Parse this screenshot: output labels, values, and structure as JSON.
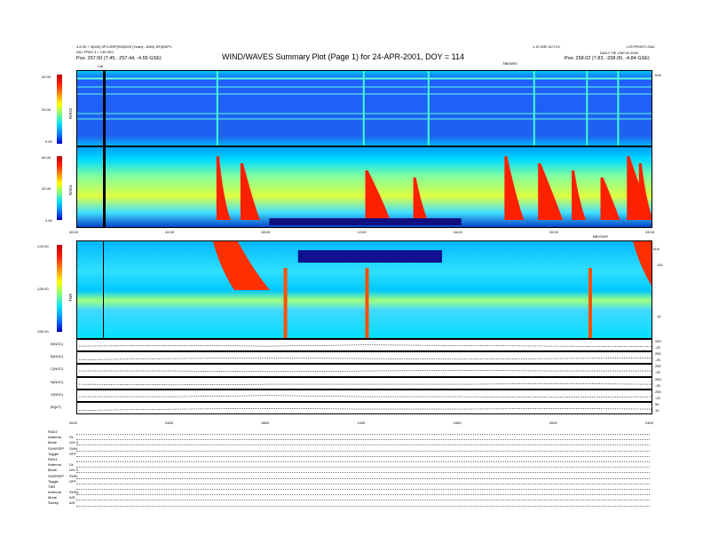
{
  "header": {
    "title": "WIND/WAVES Summary Plot (Page 1) for 24-APR-2001, DOY = 114",
    "topleft_line1": "4.5.30 + 3(000) SPC/SRP(500)000 (Yearly - ANN) DF@3/PC",
    "topleft_line2": "ASJ PRIIS 3 = 135 0E0",
    "position_left": "Pos:    257.50 (7.45, -257.44, -4.55 GSE)",
    "topright_line1": "1.10 WEI 01/TC0",
    "topright_line2": "L39 FRONT=SAC",
    "topright_line3": "DAILY TIE CNP IN 2000",
    "position_right": "Pos:    258.02 (7.83, -258.05, -4.84 GSE)",
    "center_right_label": "TBEWEE",
    "cal_marker": "Cal"
  },
  "panels": {
    "rad2": {
      "name": "RAD2",
      "ticks": [
        "40.00",
        "20.00",
        "0.00"
      ],
      "right_unit": "kHz"
    },
    "rad1": {
      "name": "RAD1",
      "ticks": [
        "60.00",
        "30.00",
        "0.00"
      ]
    },
    "tnr": {
      "name": "TNR",
      "ticks": [
        "-120.00",
        "-135.00",
        "-150.00"
      ],
      "right_ticks": [
        "100",
        "10"
      ],
      "right_top_label": "BBV/SDF",
      "right_top_sublabel": "kHz"
    },
    "time_axis_upper": [
      "00:00",
      "04:00",
      "08:00",
      "12:00",
      "16:00",
      "20:00",
      "24:00"
    ],
    "time_axis_lower": [
      "0000",
      "0400",
      "0800",
      "1200",
      "1600",
      "2000",
      "2400"
    ]
  },
  "mag_panels": [
    {
      "label": "B(NOC)",
      "r1": "250",
      "r2": "-25"
    },
    {
      "label": "B(NOC)",
      "r1": "250",
      "r2": "-25"
    },
    {
      "label": "C(NOC)",
      "r1": "250",
      "r2": "-25"
    },
    {
      "label": "N(NOC)",
      "r1": "250",
      "r2": "-25"
    },
    {
      "label": "V(NOC)",
      "r1": "250",
      "r2": "-25"
    },
    {
      "label": "|B|(nT)",
      "r1": "50",
      "r2": "15"
    }
  ],
  "mode_table": [
    {
      "key": "RAD2",
      "value": ""
    },
    {
      "key": "Antenna",
      "value": "Sx"
    },
    {
      "key": "Mode",
      "value": "LIN S"
    },
    {
      "key": "SUM/SEP",
      "value": "SUM"
    },
    {
      "key": "Toggle",
      "value": "OFF"
    },
    {
      "key": "RAD1",
      "value": ""
    },
    {
      "key": "Antenna",
      "value": "Sx"
    },
    {
      "key": "Mode",
      "value": "LIN S"
    },
    {
      "key": "SUM/SEP",
      "value": "SUM"
    },
    {
      "key": "Toggle",
      "value": "OFF"
    },
    {
      "key": "TNR",
      "value": ""
    },
    {
      "key": "Antenna",
      "value": "Sx/Ey"
    },
    {
      "key": "Mode",
      "value": "A/D"
    },
    {
      "key": "Sweep",
      "value": "A/D"
    }
  ],
  "chart_data": [
    {
      "type": "heatmap",
      "panel": "RAD2",
      "ylim": [
        0,
        40
      ],
      "xlim": [
        "00:00",
        "24:00"
      ],
      "bursts_hours": [
        5.8,
        11.9,
        14.6,
        19.0,
        21.2,
        22.5
      ]
    },
    {
      "type": "heatmap",
      "panel": "RAD1",
      "ylim": [
        0,
        60
      ],
      "xlim": [
        "00:00",
        "24:00"
      ],
      "bursts_hours": [
        5.8,
        6.8,
        12.0,
        14.0,
        17.8,
        19.2,
        20.6,
        21.8,
        22.9,
        23.4
      ]
    },
    {
      "type": "heatmap",
      "panel": "TNR",
      "ylim": [
        -150,
        -120
      ],
      "xlim": [
        "00:00",
        "24:00"
      ],
      "bursts_hours": [
        5.8,
        8.6,
        12.0,
        21.3,
        23.3
      ]
    },
    {
      "type": "line",
      "panel": "mag",
      "series": [
        {
          "name": "B(NOC)",
          "values": [
            0.5,
            0.55,
            0.5,
            0.6,
            0.55,
            0.5,
            0.45
          ]
        },
        {
          "name": "B(NOC)",
          "values": [
            0.4,
            0.5,
            0.55,
            0.5,
            0.45,
            0.5,
            0.55
          ]
        },
        {
          "name": "C(NOC)",
          "values": [
            0.5,
            0.5,
            0.45,
            0.5,
            0.55,
            0.5,
            0.5
          ]
        },
        {
          "name": "N(NOC)",
          "values": [
            0.5,
            0.45,
            0.5,
            0.5,
            0.5,
            0.55,
            0.5
          ]
        },
        {
          "name": "V(NOC)",
          "values": [
            0.5,
            0.5,
            0.6,
            0.5,
            0.5,
            0.45,
            0.5
          ]
        },
        {
          "name": "|B|(nT)",
          "values": [
            0.4,
            0.5,
            0.55,
            0.5,
            0.5,
            0.55,
            0.5
          ]
        }
      ]
    }
  ]
}
